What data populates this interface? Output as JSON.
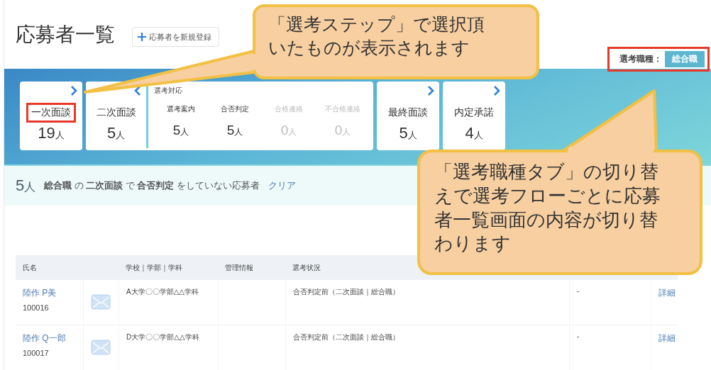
{
  "page": {
    "title": "応募者一覧",
    "add_button": "応募者を新規登録"
  },
  "job_type": {
    "label": "選考職種：",
    "highlighted": true,
    "tabs": [
      {
        "label": "総合職",
        "selected": true
      }
    ]
  },
  "steps": [
    {
      "kind": "card",
      "label": "一次面談",
      "count": "19",
      "unit": "人",
      "expanded": false,
      "highlighted": true
    },
    {
      "kind": "group",
      "label": "二次面談",
      "count": "5",
      "unit": "人",
      "expanded": true,
      "highlighted": false,
      "group_title": "選考対応",
      "items": [
        {
          "label": "選考案内",
          "count": "5",
          "unit": "人",
          "disabled": false
        },
        {
          "label": "合否判定",
          "count": "5",
          "unit": "人",
          "disabled": false
        },
        {
          "label": "合格連絡",
          "count": "0",
          "unit": "人",
          "disabled": true
        },
        {
          "label": "不合格連絡",
          "count": "0",
          "unit": "人",
          "disabled": true
        }
      ]
    },
    {
      "kind": "card",
      "label": "最終面談",
      "count": "5",
      "unit": "人",
      "expanded": false,
      "highlighted": false
    },
    {
      "kind": "card",
      "label": "内定承諾",
      "count": "4",
      "unit": "人",
      "expanded": false,
      "highlighted": false
    }
  ],
  "summary": {
    "count": "5",
    "unit": "人",
    "text": "**総合職** の **二次面談** で **合否判定** をしていない応募者",
    "clear": "クリア"
  },
  "table": {
    "columns": [
      "氏名",
      "学校｜学部｜学科",
      "管理情報",
      "選考状況"
    ],
    "rows": [
      {
        "name": "陸作 P美",
        "id": "100016",
        "school": "A大学〇〇学部△△学科",
        "status": "合否判定前（二次面談｜総合職）",
        "column_5": "-",
        "action": "詳細"
      },
      {
        "name": "陸作 Q一郎",
        "id": "100017",
        "school": "D大学〇〇学部△△学科",
        "status": "合否判定前（二次面談｜総合職）",
        "column_5": "-",
        "action": "詳細"
      }
    ]
  },
  "callouts": [
    {
      "text": "「選考ステップ」で選択頂いたものが表示されます"
    },
    {
      "text": "「選考職種タブ」の切り替えで選考フローごとに応募者一覧画面の内容が切り替わります"
    }
  ]
}
